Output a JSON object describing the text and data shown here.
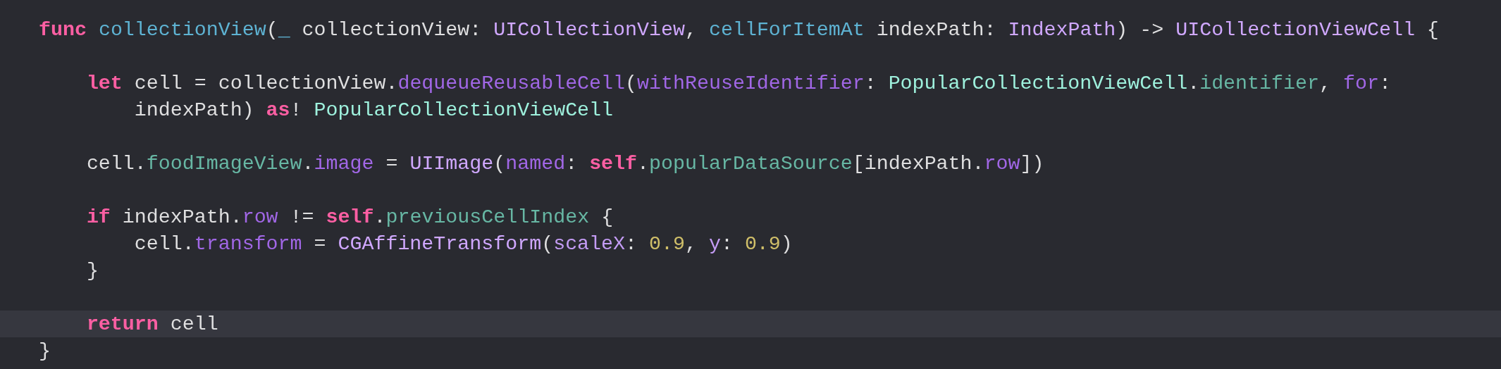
{
  "editor": {
    "lines": [
      {
        "kind": "code",
        "highlighted": false,
        "tokens": [
          {
            "text": "func ",
            "kind": "keyword"
          },
          {
            "text": "collectionView",
            "kind": "declaration"
          },
          {
            "text": "(",
            "kind": "plain"
          },
          {
            "text": "_",
            "kind": "declaration"
          },
          {
            "text": " collectionView: ",
            "kind": "plain"
          },
          {
            "text": "UICollectionView",
            "kind": "type"
          },
          {
            "text": ", ",
            "kind": "plain"
          },
          {
            "text": "cellForItemAt",
            "kind": "declaration"
          },
          {
            "text": " indexPath: ",
            "kind": "plain"
          },
          {
            "text": "IndexPath",
            "kind": "type"
          },
          {
            "text": ") -> ",
            "kind": "plain"
          },
          {
            "text": "UICollectionViewCell",
            "kind": "type"
          },
          {
            "text": " {",
            "kind": "plain"
          }
        ],
        "children": [
          {
            "kind": "blank"
          },
          {
            "kind": "code",
            "highlighted": false,
            "tokens": [
              {
                "text": "let",
                "kind": "keyword"
              },
              {
                "text": " cell = collectionView.",
                "kind": "plain"
              },
              {
                "text": "dequeueReusableCell",
                "kind": "method"
              },
              {
                "text": "(",
                "kind": "plain"
              },
              {
                "text": "withReuseIdentifier",
                "kind": "method"
              },
              {
                "text": ": ",
                "kind": "plain"
              },
              {
                "text": "PopularCollectionViewCell",
                "kind": "project_type"
              },
              {
                "text": ".",
                "kind": "plain"
              },
              {
                "text": "identifier",
                "kind": "project_member"
              },
              {
                "text": ", ",
                "kind": "plain"
              },
              {
                "text": "for",
                "kind": "method"
              },
              {
                "text": ":",
                "kind": "plain"
              }
            ],
            "children": [
              {
                "kind": "code",
                "highlighted": false,
                "tokens": [
                  {
                    "text": "indexPath) ",
                    "kind": "plain"
                  },
                  {
                    "text": "as",
                    "kind": "keyword"
                  },
                  {
                    "text": "! ",
                    "kind": "plain"
                  },
                  {
                    "text": "PopularCollectionViewCell",
                    "kind": "project_type"
                  }
                ]
              }
            ]
          },
          {
            "kind": "blank"
          },
          {
            "kind": "code",
            "highlighted": false,
            "tokens": [
              {
                "text": "cell.",
                "kind": "plain"
              },
              {
                "text": "foodImageView",
                "kind": "project_member"
              },
              {
                "text": ".",
                "kind": "plain"
              },
              {
                "text": "image",
                "kind": "method"
              },
              {
                "text": " = ",
                "kind": "plain"
              },
              {
                "text": "UIImage",
                "kind": "type"
              },
              {
                "text": "(",
                "kind": "plain"
              },
              {
                "text": "named",
                "kind": "method"
              },
              {
                "text": ": ",
                "kind": "plain"
              },
              {
                "text": "self",
                "kind": "keyword"
              },
              {
                "text": ".",
                "kind": "plain"
              },
              {
                "text": "popularDataSource",
                "kind": "project_member"
              },
              {
                "text": "[indexPath.",
                "kind": "plain"
              },
              {
                "text": "row",
                "kind": "method"
              },
              {
                "text": "])",
                "kind": "plain"
              }
            ]
          },
          {
            "kind": "blank"
          },
          {
            "kind": "code",
            "highlighted": false,
            "tokens": [
              {
                "text": "if",
                "kind": "keyword"
              },
              {
                "text": " indexPath.",
                "kind": "plain"
              },
              {
                "text": "row",
                "kind": "method"
              },
              {
                "text": " != ",
                "kind": "plain"
              },
              {
                "text": "self",
                "kind": "keyword"
              },
              {
                "text": ".",
                "kind": "plain"
              },
              {
                "text": "previousCellIndex",
                "kind": "project_member"
              },
              {
                "text": " {",
                "kind": "plain"
              }
            ],
            "children": [
              {
                "kind": "code",
                "highlighted": false,
                "tokens": [
                  {
                    "text": "cell.",
                    "kind": "plain"
                  },
                  {
                    "text": "transform",
                    "kind": "method"
                  },
                  {
                    "text": " = ",
                    "kind": "plain"
                  },
                  {
                    "text": "CGAffineTransform",
                    "kind": "type"
                  },
                  {
                    "text": "(",
                    "kind": "plain"
                  },
                  {
                    "text": "scaleX",
                    "kind": "label"
                  },
                  {
                    "text": ": ",
                    "kind": "plain"
                  },
                  {
                    "text": "0.9",
                    "kind": "number"
                  },
                  {
                    "text": ", ",
                    "kind": "plain"
                  },
                  {
                    "text": "y",
                    "kind": "label"
                  },
                  {
                    "text": ": ",
                    "kind": "plain"
                  },
                  {
                    "text": "0.9",
                    "kind": "number"
                  },
                  {
                    "text": ")",
                    "kind": "plain"
                  }
                ]
              }
            ]
          },
          {
            "kind": "code",
            "highlighted": false,
            "tokens": [
              {
                "text": "}",
                "kind": "plain"
              }
            ]
          },
          {
            "kind": "blank"
          },
          {
            "kind": "code",
            "highlighted": true,
            "tokens": [
              {
                "text": "return",
                "kind": "keyword"
              },
              {
                "text": " cell",
                "kind": "plain"
              }
            ]
          }
        ]
      },
      {
        "kind": "code",
        "highlighted": false,
        "tokens": [
          {
            "text": "}",
            "kind": "plain"
          }
        ]
      }
    ]
  }
}
